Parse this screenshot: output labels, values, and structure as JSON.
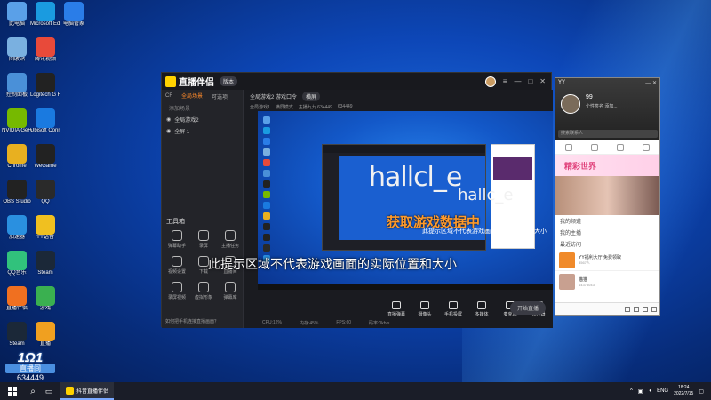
{
  "desktop": {
    "icons": [
      {
        "label": "此电脑",
        "icon": "computer-icon",
        "color": "#5aa0e8"
      },
      {
        "label": "Microsoft Edge",
        "icon": "edge-icon",
        "color": "#1a9be0"
      },
      {
        "label": "电脑管家",
        "icon": "shield-icon",
        "color": "#2a7de8"
      },
      {
        "label": "回收站",
        "icon": "recycle-bin-icon",
        "color": "#7ab0e0"
      },
      {
        "label": "腾讯视频",
        "icon": "video-icon",
        "color": "#e84a3a"
      },
      {
        "label": "控制面板",
        "icon": "control-panel-icon",
        "color": "#4a90d8"
      },
      {
        "label": "Logitech G HUB",
        "icon": "logitech-icon",
        "color": "#222222"
      },
      {
        "label": "NVIDIA GeForce",
        "icon": "nvidia-icon",
        "color": "#76b900"
      },
      {
        "label": "Ubisoft Connect",
        "icon": "ubisoft-icon",
        "color": "#1a7ae0"
      },
      {
        "label": "Chrome",
        "icon": "chrome-icon",
        "color": "#e8b020"
      },
      {
        "label": "WeGame",
        "icon": "wegame-icon",
        "color": "#222222"
      },
      {
        "label": "OBS Studio",
        "icon": "obs-icon",
        "color": "#222222"
      },
      {
        "label": "QQ",
        "icon": "qq-icon",
        "color": "#2a2a2a"
      },
      {
        "label": "加速器",
        "icon": "accelerator-icon",
        "color": "#2a90e0"
      },
      {
        "label": "YY语音",
        "icon": "yy-icon",
        "color": "#f0c020"
      },
      {
        "label": "QQ音乐",
        "icon": "music-icon",
        "color": "#31c27c"
      },
      {
        "label": "Steam",
        "icon": "steam-icon",
        "color": "#1b2838"
      },
      {
        "label": "直播伴侣",
        "icon": "stream-companion-icon",
        "color": "#f07020"
      },
      {
        "label": "游戏",
        "icon": "game-icon",
        "color": "#3ab050"
      },
      {
        "label": "Steam",
        "icon": "steam-icon",
        "color": "#1b2838"
      },
      {
        "label": "直播",
        "icon": "live-icon",
        "color": "#f0a020"
      }
    ]
  },
  "stream_badge": {
    "line1": "1Ω1",
    "line2": "直播间",
    "line3": "634449"
  },
  "main_window": {
    "title": "直播伴侣",
    "version_tag": "版本",
    "left_tabs": [
      "CF",
      "全局场景",
      "可选项"
    ],
    "sub_label": "添加场景",
    "scenes": [
      "全局游戏2",
      "全屏 1"
    ],
    "tools_title": "工具箱",
    "tools": [
      "弹幕助手",
      "录屏",
      "主播任务",
      "视频设置",
      "下载",
      "直播间",
      "录屏视频",
      "虚拟形象",
      "弹幕库"
    ],
    "footer_hint": "如何把手机连接直播画面？",
    "header": {
      "scene_name": "全局游戏2 游戏口令",
      "tag": "横屏"
    },
    "subline": [
      "全局游戏1",
      "横屏模式",
      "主播九九 634449",
      "634449"
    ],
    "watermark_big": "hallcl_e",
    "watermark_small": "hallc_e",
    "orange_text": "获取游戏数据中",
    "inner_hint": "此提示区域不代表游戏画面的实际位置和大小",
    "bottom_buttons": [
      "直播弹幕",
      "摄像头",
      "手机投屏",
      "多媒体",
      "麦克风",
      "扬声器"
    ],
    "start_button": "开始直播",
    "status": [
      "CPU:12%",
      "内存:45%",
      "FPS:60",
      "码率:0kb/s"
    ]
  },
  "caption": "此提示区域不代表游戏画面的实际位置和大小",
  "right_panel": {
    "app": "YY",
    "window_controls": "— ✕",
    "user_name": "99",
    "signature": "个性签名 添加...",
    "search_placeholder": "搜索联系人",
    "banner_title": "精彩世界",
    "sections": [
      "我的频道",
      "我的主播",
      "最近访问"
    ],
    "items": [
      {
        "title": "YY福利大厅 免费领取",
        "sub": "3567人"
      },
      {
        "title": "猫猫",
        "sub": "14375043"
      }
    ]
  },
  "taskbar": {
    "app_label": "抖音直播伴侣",
    "lang": "ENG",
    "time": "18:24",
    "date": "2022/7/15"
  }
}
